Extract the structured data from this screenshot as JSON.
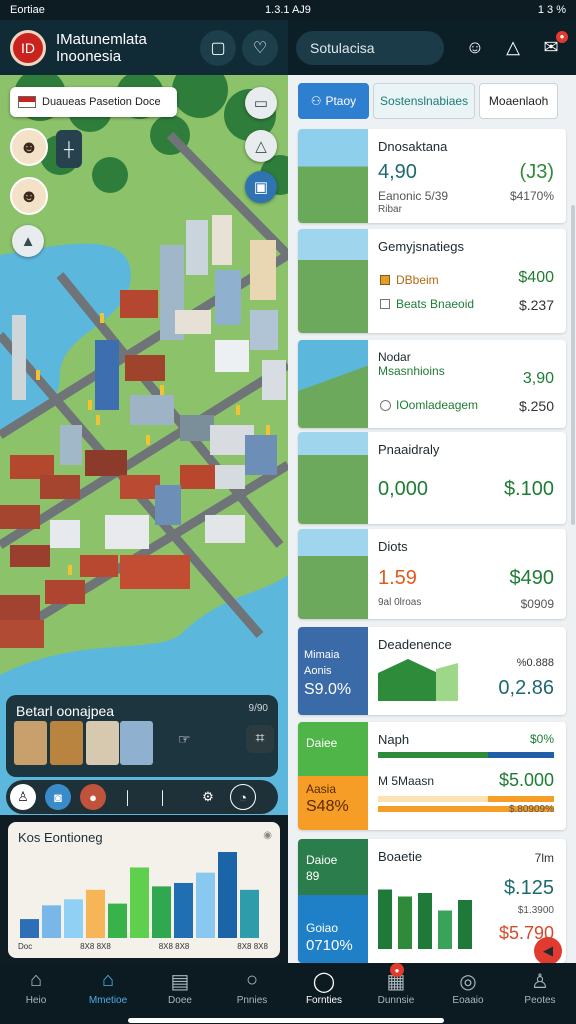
{
  "status_bar": {
    "left": "Eortiae",
    "center": "1.3.1 AJ9",
    "right": "1 3 %"
  },
  "left_header": {
    "title": "IMatunemlata Inoonesia",
    "logo_text": "ID"
  },
  "right_header": {
    "search": "Sotulacisa"
  },
  "map": {
    "location_tag": "Duaueas  Pasetion Doce",
    "build_panel": {
      "title": "Betarl oonajpea",
      "meta": "9/90"
    }
  },
  "economy": {
    "title": "Kos Eontioneg",
    "axis_labels": [
      "Doc",
      "8X8 8X8",
      "8X8 8X8",
      "8X8 8X8"
    ],
    "bars": [
      {
        "value": 0.22,
        "color": "#2d6fb7"
      },
      {
        "value": 0.38,
        "color": "#79b7e8"
      },
      {
        "value": 0.45,
        "color": "#8fd0f4"
      },
      {
        "value": 0.56,
        "color": "#f6b657"
      },
      {
        "value": 0.4,
        "color": "#3ab24a"
      },
      {
        "value": 0.82,
        "color": "#5fcf4e"
      },
      {
        "value": 0.6,
        "color": "#2fa84f"
      },
      {
        "value": 0.64,
        "color": "#1f6fb2"
      },
      {
        "value": 0.76,
        "color": "#8ac9ef"
      },
      {
        "value": 1.0,
        "color": "#1c64a8"
      },
      {
        "value": 0.56,
        "color": "#2e9cab"
      }
    ]
  },
  "tabs": [
    "Ptaoy",
    "Sostenslnabiaes",
    "Moaenlaoh"
  ],
  "cards": [
    {
      "title": "Dnosaktana",
      "big_left": "4,90",
      "big_right": "(J3)",
      "sub_left": "Eanonic 5/39",
      "sub_right": "$4170%",
      "sub_left2": "Ribar"
    },
    {
      "title": "Gemyjsnatiegs",
      "row1_left": "DBbeim",
      "row1_right": "$400",
      "row2_left": "Beats Bnaeoid",
      "row2_right": "$.237"
    },
    {
      "title": "Nodar",
      "subtitle": "Msasnhioins",
      "big_right": "3,90",
      "row_left": "IOomladeagem",
      "row_right": "$.250"
    },
    {
      "title": "Pnaaidraly",
      "big_left": "0,000",
      "big_right": "$.100"
    },
    {
      "title": "Diots",
      "big_left": "1.59",
      "big_right": "$490",
      "sub_left": "9al 0lroas",
      "sub_right": "$0909"
    },
    {
      "title": "Deadenence",
      "left_label1": "Mimaia",
      "left_label2": "Aonis",
      "left_value": "S9.0%",
      "right_top": "%0.888",
      "right_big": "0,2.86"
    },
    {
      "title": "Naph",
      "pct": "$0%",
      "left_label": "Daiee",
      "left_label2": "Aasia",
      "left_value": "S48%",
      "row_label": "M 5Maasn",
      "row_value": "$5.000",
      "row_sub": "$.80909%"
    },
    {
      "title": "Boaetie",
      "right_top": "7lm",
      "left_label": "Daioe",
      "left_value": "89",
      "left_label2": "Goiao",
      "left_value2": "0710%",
      "big": "$.125",
      "sub": "$1.3900",
      "big2": "$5.790"
    }
  ],
  "nav": [
    "Heio",
    "Mmetioe",
    "Doee",
    "Pnnies",
    "Fornties",
    "Dunnsie",
    "Eoaaio",
    "Peotes"
  ]
}
